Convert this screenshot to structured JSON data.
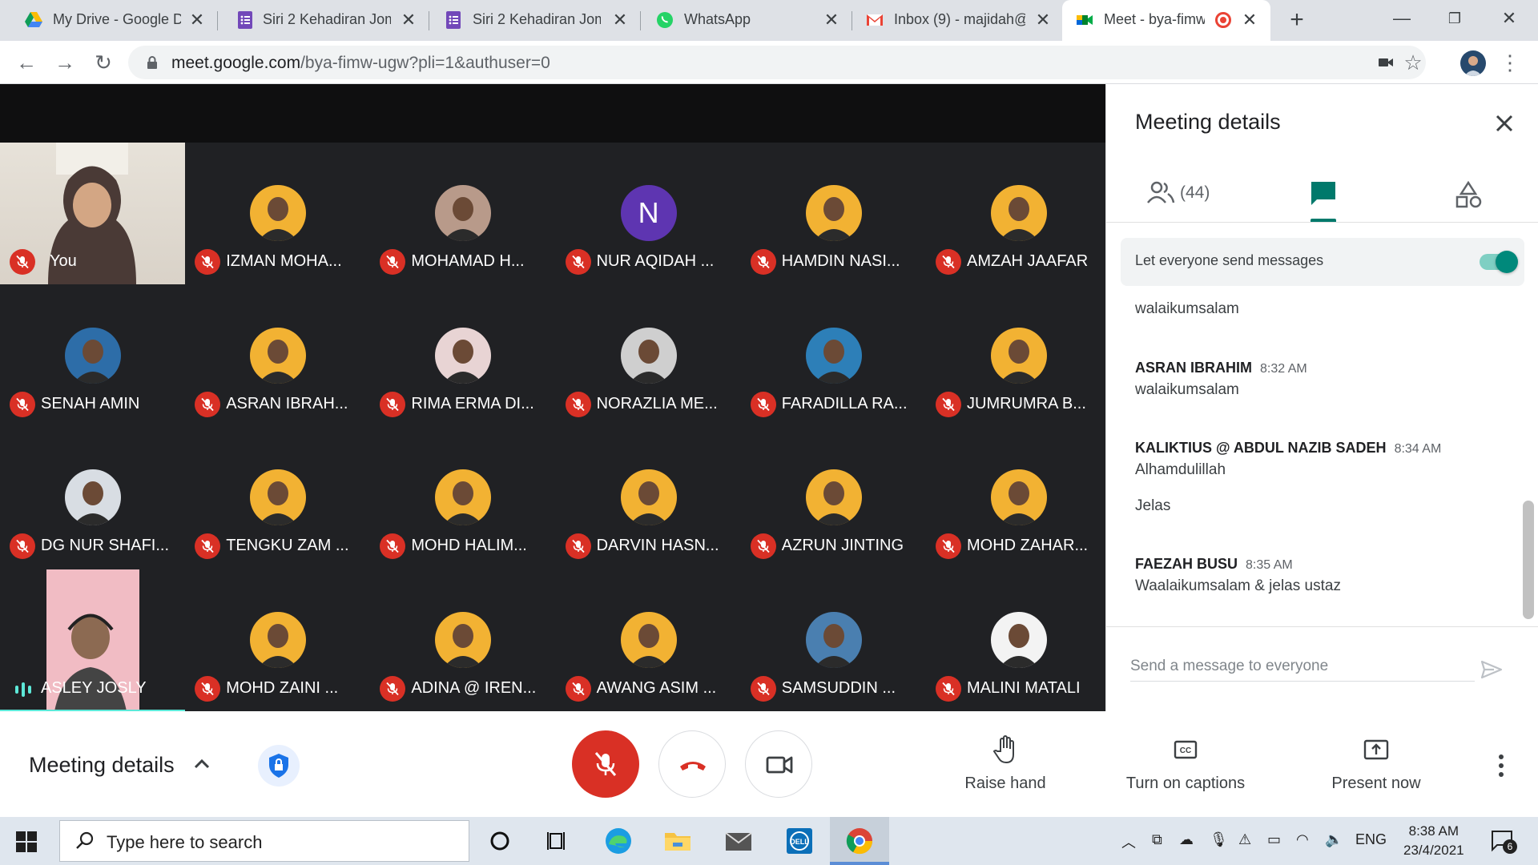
{
  "browser": {
    "tabs": [
      {
        "title": "My Drive - Google D",
        "icon": "google-drive-icon"
      },
      {
        "title": "Siri 2 Kehadiran Jom",
        "icon": "google-forms-icon"
      },
      {
        "title": "Siri 2 Kehadiran Jom",
        "icon": "google-forms-icon"
      },
      {
        "title": "WhatsApp",
        "icon": "whatsapp-icon"
      },
      {
        "title": "Inbox (9) - majidah@",
        "icon": "gmail-icon"
      },
      {
        "title": "Meet - bya-fimw",
        "icon": "google-meet-icon",
        "active": true
      }
    ],
    "url_host": "meet.google.com",
    "url_path": "/bya-fimw-ugw?pli=1&authuser=0"
  },
  "participants": [
    {
      "name": "You",
      "type": "self-video"
    },
    {
      "name": "IZMAN MOHA...",
      "avatar_color": "#f2b233"
    },
    {
      "name": "MOHAMAD H...",
      "avatar_color": "#b89a8a"
    },
    {
      "name": "NUR AQIDAH ...",
      "initial": "N",
      "avatar_color": "#5e35b1"
    },
    {
      "name": "HAMDIN NASI...",
      "avatar_color": "#f2b233"
    },
    {
      "name": "AMZAH JAAFAR",
      "avatar_color": "#f2b233"
    },
    {
      "name": "SENAH AMIN",
      "avatar_color": "#2d6da8"
    },
    {
      "name": "ASRAN IBRAH...",
      "avatar_color": "#f2b233"
    },
    {
      "name": "RIMA ERMA DI...",
      "avatar_color": "#e8d4d4"
    },
    {
      "name": "NORAZLIA ME...",
      "avatar_color": "#cfcfcf"
    },
    {
      "name": "FARADILLA RA...",
      "avatar_color": "#2d7fb8"
    },
    {
      "name": "JUMRUMRA B...",
      "avatar_color": "#f2b233"
    },
    {
      "name": "DG NUR SHAFI...",
      "avatar_color": "#d8dde3"
    },
    {
      "name": "TENGKU ZAM ...",
      "avatar_color": "#f2b233"
    },
    {
      "name": "MOHD HALIM...",
      "avatar_color": "#f2b233"
    },
    {
      "name": "DARVIN HASN...",
      "avatar_color": "#f2b233"
    },
    {
      "name": "AZRUN JINTING",
      "avatar_color": "#f2b233"
    },
    {
      "name": "MOHD ZAHAR...",
      "avatar_color": "#f2b233"
    },
    {
      "name": "ASLEY JOSLY",
      "type": "speaking-video"
    },
    {
      "name": "MOHD ZAINI ...",
      "avatar_color": "#f2b233"
    },
    {
      "name": "ADINA @ IREN...",
      "avatar_color": "#f2b233"
    },
    {
      "name": "AWANG ASIM ...",
      "avatar_color": "#f2b233"
    },
    {
      "name": "SAMSUDDIN ...",
      "avatar_color": "#4a7fb0"
    },
    {
      "name": "MALINI MATALI",
      "avatar_color": "#f3f3f3"
    }
  ],
  "panel": {
    "title": "Meeting details",
    "people_count": "(44)",
    "toggle_label": "Let everyone send messages",
    "messages": [
      {
        "sender": "",
        "time": "",
        "lines": [
          "walaikumsalam"
        ]
      },
      {
        "sender": "ASRAN IBRAHIM",
        "time": "8:32 AM",
        "lines": [
          "walaikumsalam"
        ]
      },
      {
        "sender": "KALIKTIUS @ ABDUL NAZIB SADEH",
        "time": "8:34 AM",
        "lines": [
          "Alhamdulillah",
          "Jelas"
        ]
      },
      {
        "sender": "FAEZAH BUSU",
        "time": "8:35 AM",
        "lines": [
          "Waalaikumsalam & jelas ustaz"
        ]
      }
    ],
    "compose_placeholder": "Send a message to everyone"
  },
  "bottombar": {
    "meeting_details": "Meeting details",
    "raise_hand": "Raise hand",
    "captions": "Turn on captions",
    "present": "Present now"
  },
  "taskbar": {
    "search_placeholder": "Type here to search",
    "lang": "ENG",
    "time": "8:38 AM",
    "date": "23/4/2021",
    "notif_count": "6"
  },
  "colors": {
    "stage_bg": "#202124",
    "mute_red": "#d93025",
    "accent_teal": "#00796b"
  }
}
